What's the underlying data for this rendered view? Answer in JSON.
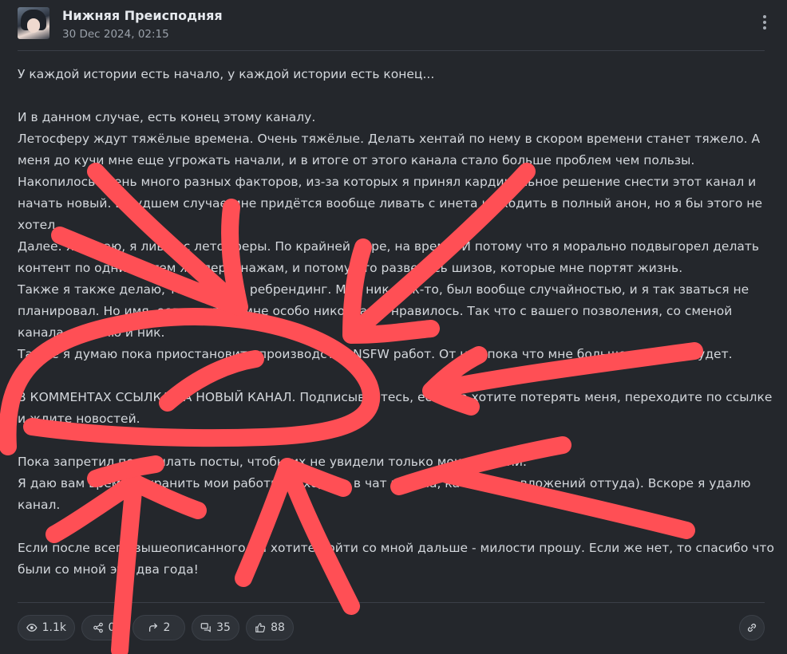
{
  "channel": {
    "name": "Нижняя Преисподняя",
    "date": "30 Dec 2024, 02:15"
  },
  "post": {
    "paragraphs": [
      "У каждой истории есть начало, у каждой истории есть конец...",
      "",
      "И в данном случае, есть конец этому каналу.",
      "Летосферу ждут тяжёлые времена. Очень тяжёлые. Делать хентай по нему в скором времени станет тяжело. А меня до кучи мне еще угрожать начали, и в итоге от этого канала стало больше проблем чем пользы.",
      "Накопилось очень много разных факторов, из-за которых я принял кардинальное решение снести этот канал и начать новый. В худшем случае мне придётся вообще ливать с инета и уходить в полный анон, но я бы этого не хотел.",
      "Далее. Я думаю, я ливну с летосферы. По крайней мере, на время. И потому что я морально подвыгорел делать контент по одним и тем же персонажам, и потому что развелось шизов, которые мне портят жизнь.",
      "Также я также делаю, так сказать ребрендинг. Мой ник, как-то, был вообще случайностью, и я так зваться не планировал. Но имя, если честно, мне особо никогда не нравилось. Так что с вашего позволения, со сменой канала я сменю и ник.",
      "Также я думаю пока приостановить производство NSFW работ. От них пока что мне больше проблем будет.",
      "",
      "В КОММЕНТАХ ССЫЛКА НА НОВЫЙ КАНАЛ. Подписывайтесь, если не хотите потерять меня, переходите по ссылке и ждите новостей.",
      "",
      "Пока запретил пересылать посты, чтобы их не увидели только мои оратюни.",
      "Я даю вам время сохранить мои работы (заходите в чат канала, качайте из вложений оттуда). Вскоре я удалю канал.",
      "",
      "Если после всего вышеописанного вы хотите пойти со мной дальше - милости прошу. Если же нет, то спасибо что были со мной эти два года!"
    ]
  },
  "stats": {
    "views": "1.1k",
    "shares": "0",
    "forwards": "2",
    "comments": "35",
    "likes": "88"
  },
  "icons": {
    "views": "eye-icon",
    "shares": "share-icon",
    "forwards": "forward-icon",
    "comments": "comments-icon",
    "likes": "thumbs-up-icon",
    "link": "link-icon",
    "menu": "more-vertical-icon"
  },
  "colors": {
    "background": "#24272c",
    "text": "#d3d7dc",
    "overlay_scribble": "#ff4f55"
  }
}
